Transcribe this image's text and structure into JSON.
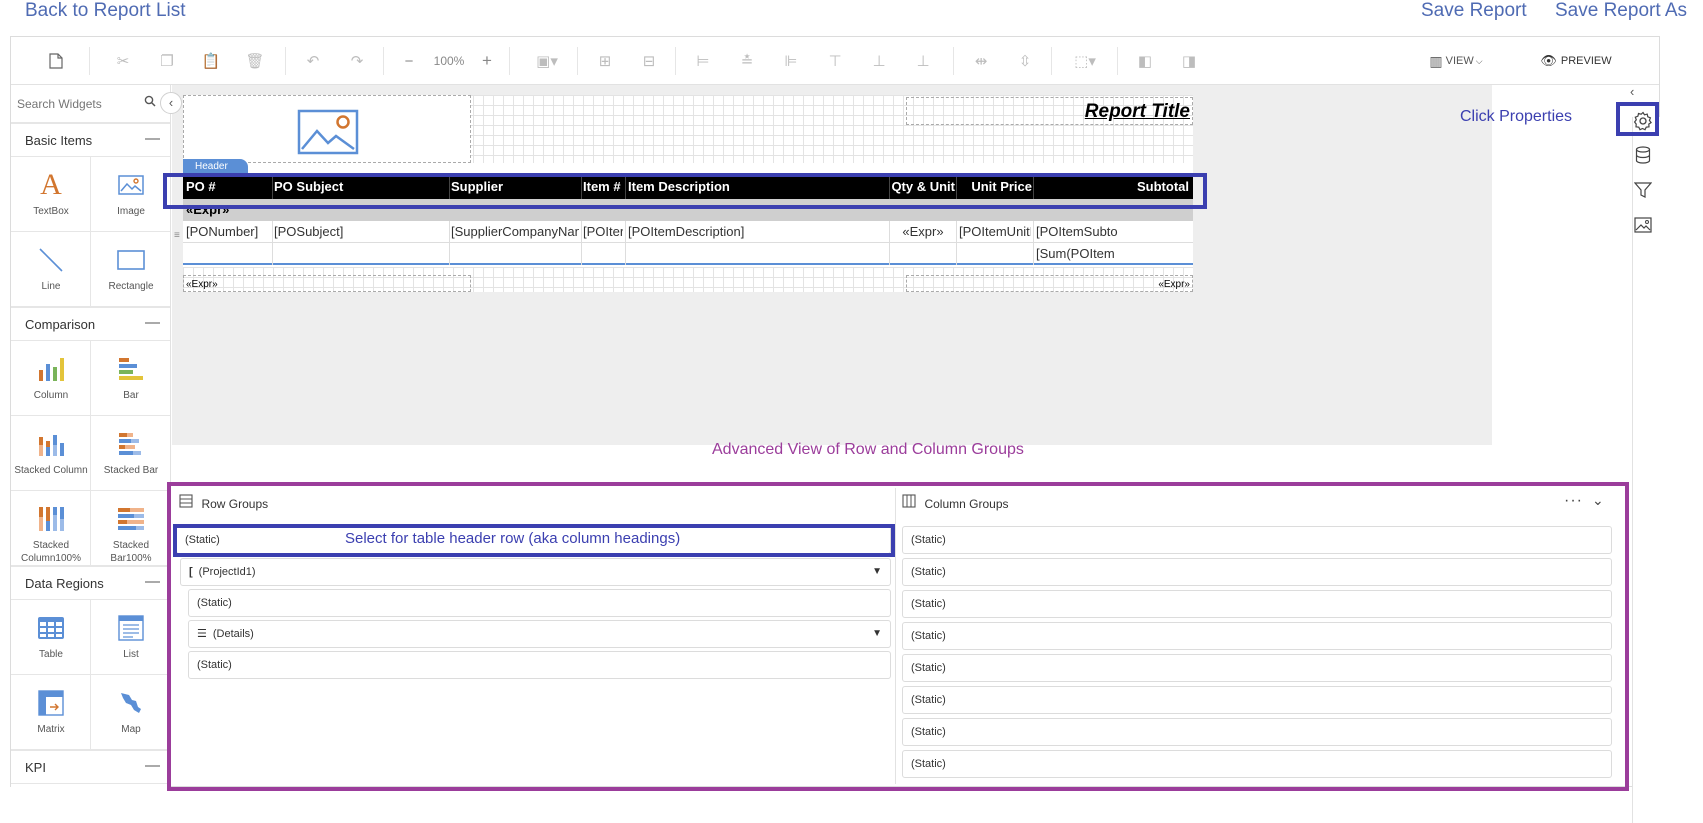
{
  "nav": {
    "back": "Back to Report List",
    "save": "Save Report",
    "save_as": "Save Report As"
  },
  "toolbar": {
    "zoom": "100%",
    "view": "VIEW",
    "preview": "PREVIEW"
  },
  "palette": {
    "search_placeholder": "Search Widgets",
    "categories": {
      "basic": "Basic Items",
      "comparison": "Comparison",
      "data_regions": "Data Regions",
      "kpi": "KPI"
    },
    "collapse_symbol": "—",
    "widgets": {
      "textbox": "TextBox",
      "image": "Image",
      "line": "Line",
      "rectangle": "Rectangle",
      "column": "Column",
      "bar": "Bar",
      "stacked_column": "Stacked Column",
      "stacked_bar": "Stacked Bar",
      "stacked_column100": "Stacked Column100%",
      "stacked_bar100": "Stacked Bar100%",
      "table": "Table",
      "list": "List",
      "matrix": "Matrix",
      "map": "Map"
    }
  },
  "report": {
    "title": "Report Title",
    "header_tag": "Header",
    "columns": [
      "PO #",
      "PO Subject",
      "Supplier",
      "Item #",
      "Item Description",
      "Qty & Unit",
      "Unit Price",
      "Subtotal"
    ],
    "group_row": "«Expr»",
    "detail_row": [
      "[PONumber]",
      "[POSubject]",
      "[SupplierCompanyNam",
      "[POIter",
      "[POItemDescription]",
      "«Expr»",
      "[POItemUnitF",
      "[POItemSubto"
    ],
    "total_cell": "[Sum(POItem",
    "footer_left": "«Expr»",
    "footer_right": "«Expr»"
  },
  "groups": {
    "row_title": "Row Groups",
    "column_title": "Column Groups",
    "row_items": [
      "(Static)",
      "(ProjectId1)",
      "(Static)",
      "(Details)",
      "(Static)"
    ],
    "column_items": [
      "(Static)",
      "(Static)",
      "(Static)",
      "(Static)",
      "(Static)",
      "(Static)",
      "(Static)",
      "(Static)"
    ]
  },
  "annotations": {
    "click_properties": "Click Properties",
    "advanced_view": "Advanced View of Row and Column Groups",
    "select_header": "Select for table header row (aka column headings)"
  },
  "colors": {
    "link": "#4f6bb3",
    "annot_blue": "#3b3fb0",
    "annot_purple": "#9b3d9b",
    "header_bg": "#000000",
    "accent": "#5b8fd6"
  }
}
